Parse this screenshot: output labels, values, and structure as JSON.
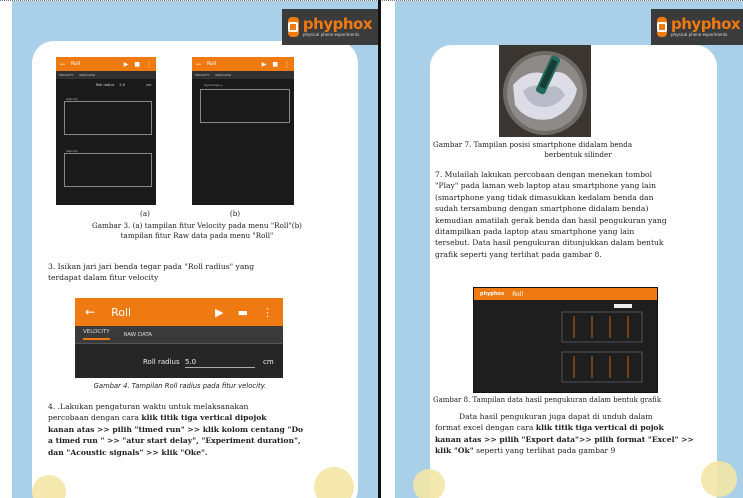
{
  "logo": {
    "name": "phyphox",
    "tagline": "physical phone experiments"
  },
  "left_page": {
    "fig3": {
      "phone_a": {
        "title": "Roll",
        "tabs": [
          "VELOCITY",
          "RAW DATA"
        ],
        "radius_label": "Roll radius",
        "radius_value": "5.0",
        "radius_unit": "cm",
        "plot1_label": "Velocity",
        "plot2_label": "Velocity"
      },
      "phone_b": {
        "title": "Roll",
        "tabs": [
          "VELOCITY",
          "RAW DATA"
        ],
        "plot1_label": "Gyroscope y"
      },
      "label_a": "(a)",
      "label_b": "(b)",
      "caption_line1": "Gambar 3. (a) tampilan fitur Velocity pada menu \"Roll\"(b)",
      "caption_line2": "tampilan fitur Raw data pada menu \"Roll\""
    },
    "step3_line1": "3.  Isikan jari jari benda tegar pada \"Roll radius\" yang",
    "step3_line2": "terdapat dalam fitur velocity",
    "fig4": {
      "title": "Roll",
      "tab_velocity": "VELOCITY",
      "tab_raw": "RAW DATA",
      "radius_label": "Roll radius",
      "radius_value": "5.0",
      "radius_unit": "cm",
      "caption": "Gambar 4. Tampilan Roll radius pada fitur velocity."
    },
    "step4": {
      "l1": "4.  .Lakukan pengaturan waktu untuk melaksanakan",
      "l2a": "percobaan dengan cara ",
      "l2b": "klik titik tiga vertical dipojok",
      "l3a": "kanan atas >> pilih \"timed run\" >> klik kolom centang \"Do",
      "l4a": "a timed run \" >> \"atur start delay\", \"Experiment duration\",",
      "l5a": "dan \"Acoustic signals\" >> klik \"Oke\"."
    }
  },
  "right_page": {
    "fig7_caption_line1": "Gambar 7. Tampilan posisi smartphone didalam benda",
    "fig7_caption_line2": "berbentuk silinder",
    "step7": [
      "7.  Mulailah lakukan percobaan dengan menekan tombol",
      "\"Play\" pada laman web laptop atau smartphone yang lain",
      "(smartphone yang tidak dimasukkan kedalam benda dan",
      "sudah tersambung dengan smartphone didalam benda)",
      "kemudian amatilah gerak benda dan hasil pengukuran yang",
      "ditampilkan pada laptop atau smartphone yang lain",
      "tersebut. Data hasil pengukuran ditunjukkan dalam bentuk",
      "grafik seperti yang terlihat pada gambar 8."
    ],
    "fig8": {
      "app": "phyphox",
      "title": "Roll",
      "caption": "Gambar 8. Tampilan data hasil pengukuran dalam bentuk grafik"
    },
    "closing": {
      "l1": "Data hasil pengukuran juga dapat di unduh dalam",
      "l2a": "format excel dengan cara ",
      "l2b": "klik titik tiga vertical di pojok",
      "l3": "kanan atas >> pilih \"Export data\">> pilih format \"Excel\" >>",
      "l4a": "klik \"Ok\"",
      "l4b": " seperti yang terlihat pada gambar 9"
    }
  }
}
